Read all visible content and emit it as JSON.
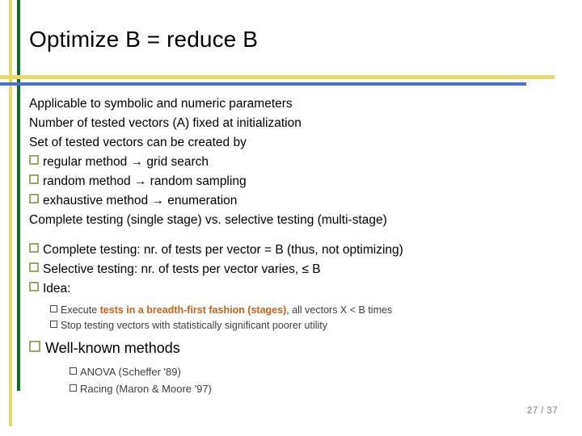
{
  "slide": {
    "title": "Optimize B = reduce B",
    "page_label": "27 / 37",
    "colors": {
      "rule_yellow": "#e8d96a",
      "rule_green": "#106b27",
      "rule_blue": "#4a6fd4",
      "bullet_square": "#9aa86a",
      "accent_bold_text": "#c4621a",
      "page_number": "#808080"
    }
  },
  "body": {
    "block1": [
      {
        "level": 1,
        "bullet": false,
        "text": "Applicable to symbolic and numeric parameters"
      },
      {
        "level": 1,
        "bullet": false,
        "text": "Number of tested vectors (A) fixed at initialization"
      },
      {
        "level": 1,
        "bullet": false,
        "text": "Set of tested vectors can be created by"
      },
      {
        "level": 2,
        "bullet": true,
        "text": "regular method → grid search"
      },
      {
        "level": 2,
        "bullet": true,
        "text": "random method → random sampling"
      },
      {
        "level": 2,
        "bullet": true,
        "text": "exhaustive method → enumeration"
      },
      {
        "level": 1,
        "bullet": false,
        "text": "Complete testing (single stage) vs. selective testing (multi-stage)"
      }
    ],
    "block2": [
      {
        "level": 2,
        "bullet": true,
        "text": "Complete testing: nr. of tests per vector = B (thus, not optimizing)"
      },
      {
        "level": 2,
        "bullet": true,
        "text": "Selective testing: nr. of tests per vector varies, ≤ B"
      },
      {
        "level": 2,
        "bullet": true,
        "text": "Idea:"
      }
    ],
    "block3": [
      {
        "level": 3,
        "bullet": true,
        "segments": [
          {
            "text": "Execute ",
            "style": "normal"
          },
          {
            "text": "tests in a breadth-first fashion (stages)",
            "style": "accent-bold"
          },
          {
            "text": ", all vectors X < B times",
            "style": "normal"
          }
        ]
      },
      {
        "level": 3,
        "bullet": true,
        "segments": [
          {
            "text": "Stop testing vectors with statistically significant poorer utility",
            "style": "normal"
          }
        ]
      }
    ],
    "block4": [
      {
        "level": 2,
        "bullet": true,
        "text": "Well-known methods"
      }
    ],
    "block5": [
      {
        "level": 4,
        "bullet": true,
        "text": "ANOVA (Scheffer '89)"
      },
      {
        "level": 4,
        "bullet": true,
        "text": "Racing (Maron & Moore '97)"
      }
    ]
  }
}
